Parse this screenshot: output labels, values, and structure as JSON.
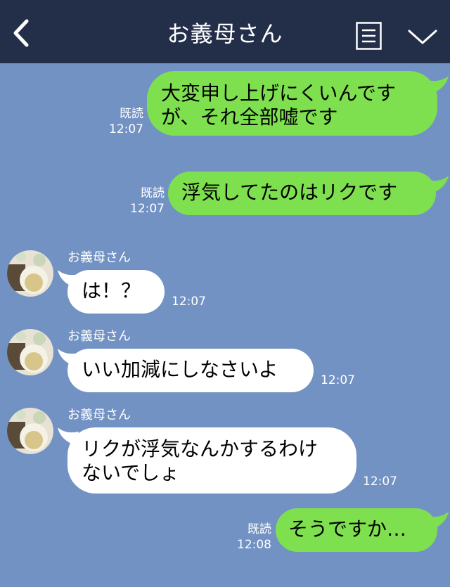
{
  "header": {
    "title": "お義母さん",
    "back_icon": "chevron-left-icon",
    "menu_icon": "list-icon",
    "dropdown_icon": "chevron-down-icon"
  },
  "colors": {
    "header_bg": "#232f49",
    "chat_bg": "#7292c3",
    "my_bubble": "#7fe04f",
    "their_bubble": "#ffffff"
  },
  "messages": [
    {
      "from": "me",
      "text": "大変申し上げにくいんです\nが、それ全部嘘です",
      "read": "既読",
      "time": "12:07"
    },
    {
      "from": "me",
      "text": "浮気してたのはリクです",
      "read": "既読",
      "time": "12:07"
    },
    {
      "from": "them",
      "sender": "お義母さん",
      "text": "は！？",
      "time": "12:07"
    },
    {
      "from": "them",
      "sender": "お義母さん",
      "text": "いい加減にしなさいよ",
      "time": "12:07"
    },
    {
      "from": "them",
      "sender": "お義母さん",
      "text": "リクが浮気なんかするわけ\nないでしょ",
      "time": "12:07"
    },
    {
      "from": "me",
      "text": "そうですか…",
      "read": "既読",
      "time": "12:08"
    }
  ]
}
